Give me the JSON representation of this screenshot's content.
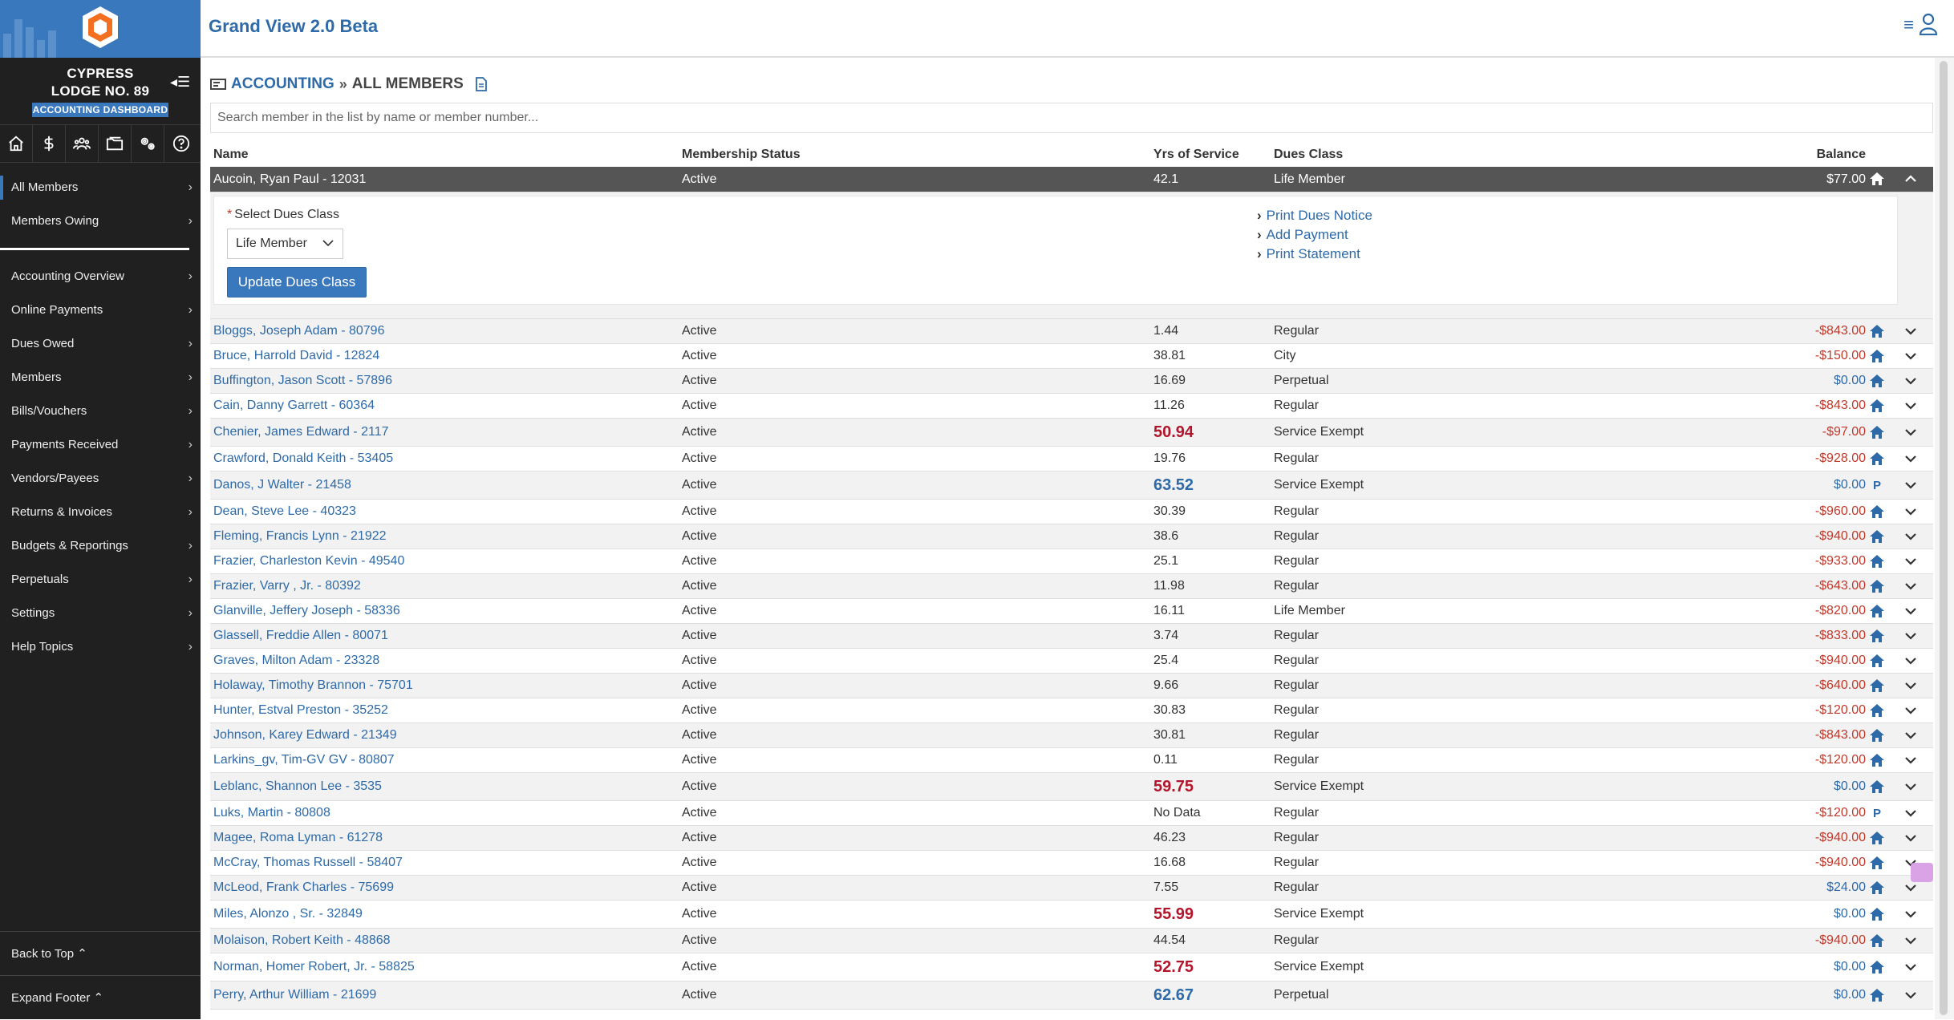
{
  "app": {
    "title": "Grand View 2.0 Beta"
  },
  "sidebar": {
    "lodge_line1": "CYPRESS",
    "lodge_line2": "LODGE NO. 89",
    "badge": "ACCOUNTING DASHBOARD",
    "icons": [
      "home-icon",
      "dollar-icon",
      "members-icon",
      "folder-icon",
      "settings-icon",
      "help-icon"
    ],
    "items_top": [
      {
        "label": "All Members",
        "active": true
      },
      {
        "label": "Members Owing",
        "active": false
      }
    ],
    "items": [
      {
        "label": "Accounting Overview"
      },
      {
        "label": "Online Payments"
      },
      {
        "label": "Dues Owed"
      },
      {
        "label": "Members"
      },
      {
        "label": "Bills/Vouchers"
      },
      {
        "label": "Payments Received"
      },
      {
        "label": "Vendors/Payees"
      },
      {
        "label": "Returns & Invoices"
      },
      {
        "label": "Budgets & Reportings"
      },
      {
        "label": "Perpetuals"
      },
      {
        "label": "Settings"
      },
      {
        "label": "Help Topics"
      }
    ],
    "back_to_top": "Back to Top ⌃",
    "expand_footer": "Expand Footer ⌃"
  },
  "breadcrumb": {
    "section": "ACCOUNTING",
    "separator": "»",
    "current": "ALL MEMBERS"
  },
  "search": {
    "placeholder": "Search member in the list by name or member number..."
  },
  "table": {
    "headers": {
      "name": "Name",
      "status": "Membership Status",
      "yrs": "Yrs of Service",
      "dues": "Dues Class",
      "balance": "Balance"
    },
    "selected": {
      "name": "Aucoin, Ryan Paul - 12031",
      "status": "Active",
      "yrs": "42.1",
      "dues": "Life Member",
      "balance": "$77.00",
      "detail": {
        "label": "Select Dues Class",
        "required_mark": "*",
        "selected_value": "Life Member",
        "button": "Update Dues Class",
        "links": [
          "Print Dues Notice",
          "Add Payment",
          "Print Statement"
        ]
      }
    },
    "rows": [
      {
        "name": "Bloggs, Joseph Adam - 80796",
        "status": "Active",
        "yrs": "1.44",
        "dues": "Regular",
        "balance": "-$843.00",
        "icon": "house"
      },
      {
        "name": "Bruce, Harrold David - 12824",
        "status": "Active",
        "yrs": "38.81",
        "dues": "City",
        "balance": "-$150.00",
        "icon": "house"
      },
      {
        "name": "Buffington, Jason Scott - 57896",
        "status": "Active",
        "yrs": "16.69",
        "dues": "Perpetual",
        "balance": "$0.00",
        "icon": "house"
      },
      {
        "name": "Cain, Danny Garrett - 60364",
        "status": "Active",
        "yrs": "11.26",
        "dues": "Regular",
        "balance": "-$843.00",
        "icon": "house"
      },
      {
        "name": "Chenier, James Edward - 2117",
        "status": "Active",
        "yrs": "50.94",
        "yrs_style": "red",
        "dues": "Service Exempt",
        "balance": "-$97.00",
        "icon": "house"
      },
      {
        "name": "Crawford, Donald Keith - 53405",
        "status": "Active",
        "yrs": "19.76",
        "dues": "Regular",
        "balance": "-$928.00",
        "icon": "house"
      },
      {
        "name": "Danos, J Walter - 21458",
        "status": "Active",
        "yrs": "63.52",
        "yrs_style": "blue",
        "dues": "Service Exempt",
        "balance": "$0.00",
        "icon": "P"
      },
      {
        "name": "Dean, Steve Lee - 40323",
        "status": "Active",
        "yrs": "30.39",
        "dues": "Regular",
        "balance": "-$960.00",
        "icon": "house"
      },
      {
        "name": "Fleming, Francis Lynn - 21922",
        "status": "Active",
        "yrs": "38.6",
        "dues": "Regular",
        "balance": "-$940.00",
        "icon": "house"
      },
      {
        "name": "Frazier, Charleston Kevin - 49540",
        "status": "Active",
        "yrs": "25.1",
        "dues": "Regular",
        "balance": "-$933.00",
        "icon": "house"
      },
      {
        "name": "Frazier, Varry , Jr. - 80392",
        "status": "Active",
        "yrs": "11.98",
        "dues": "Regular",
        "balance": "-$643.00",
        "icon": "house"
      },
      {
        "name": "Glanville, Jeffery Joseph - 58336",
        "status": "Active",
        "yrs": "16.11",
        "dues": "Life Member",
        "balance": "-$820.00",
        "icon": "house"
      },
      {
        "name": "Glassell, Freddie Allen - 80071",
        "status": "Active",
        "yrs": "3.74",
        "dues": "Regular",
        "balance": "-$833.00",
        "icon": "house"
      },
      {
        "name": "Graves, Milton Adam - 23328",
        "status": "Active",
        "yrs": "25.4",
        "dues": "Regular",
        "balance": "-$940.00",
        "icon": "house"
      },
      {
        "name": "Holaway, Timothy Brannon - 75701",
        "status": "Active",
        "yrs": "9.66",
        "dues": "Regular",
        "balance": "-$640.00",
        "icon": "house"
      },
      {
        "name": "Hunter, Estval Preston - 35252",
        "status": "Active",
        "yrs": "30.83",
        "dues": "Regular",
        "balance": "-$120.00",
        "icon": "house"
      },
      {
        "name": "Johnson, Karey Edward - 21349",
        "status": "Active",
        "yrs": "30.81",
        "dues": "Regular",
        "balance": "-$843.00",
        "icon": "house"
      },
      {
        "name": "Larkins_gv, Tim-GV GV - 80807",
        "status": "Active",
        "yrs": "0.11",
        "dues": "Regular",
        "balance": "-$120.00",
        "icon": "house"
      },
      {
        "name": "Leblanc, Shannon Lee - 3535",
        "status": "Active",
        "yrs": "59.75",
        "yrs_style": "red",
        "dues": "Service Exempt",
        "balance": "$0.00",
        "icon": "house"
      },
      {
        "name": "Luks, Martin - 80808",
        "status": "Active",
        "yrs": "No Data",
        "dues": "Regular",
        "balance": "-$120.00",
        "icon": "P"
      },
      {
        "name": "Magee, Roma Lyman - 61278",
        "status": "Active",
        "yrs": "46.23",
        "dues": "Regular",
        "balance": "-$940.00",
        "icon": "house"
      },
      {
        "name": "McCray, Thomas Russell - 58407",
        "status": "Active",
        "yrs": "16.68",
        "dues": "Regular",
        "balance": "-$940.00",
        "icon": "house"
      },
      {
        "name": "McLeod, Frank Charles - 75699",
        "status": "Active",
        "yrs": "7.55",
        "dues": "Regular",
        "balance": "$24.00",
        "icon": "house"
      },
      {
        "name": "Miles, Alonzo , Sr. - 32849",
        "status": "Active",
        "yrs": "55.99",
        "yrs_style": "red",
        "dues": "Service Exempt",
        "balance": "$0.00",
        "icon": "house"
      },
      {
        "name": "Molaison, Robert Keith - 48868",
        "status": "Active",
        "yrs": "44.54",
        "dues": "Regular",
        "balance": "-$940.00",
        "icon": "house"
      },
      {
        "name": "Norman, Homer Robert, Jr. - 58825",
        "status": "Active",
        "yrs": "52.75",
        "yrs_style": "red",
        "dues": "Service Exempt",
        "balance": "$0.00",
        "icon": "house"
      },
      {
        "name": "Perry, Arthur William - 21699",
        "status": "Active",
        "yrs": "62.67",
        "yrs_style": "blue",
        "dues": "Perpetual",
        "balance": "$0.00",
        "icon": "house"
      }
    ]
  },
  "colors": {
    "brand_blue": "#3a78bd",
    "link_blue": "#2e6aa8",
    "negative_red": "#c0392b",
    "sidebar_bg": "#202020"
  }
}
